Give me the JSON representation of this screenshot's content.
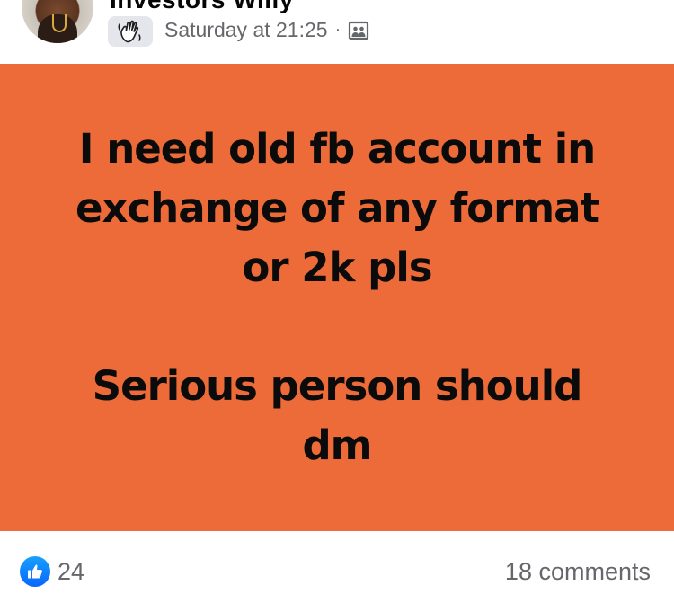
{
  "author": {
    "name": "Investors Willy"
  },
  "post_meta": {
    "timestamp": "Saturday at 21:25",
    "separator": "·",
    "audience_icon": "friends-audience-icon",
    "badge_icon": "wave-hand-icon"
  },
  "post": {
    "background_color": "#ec6b39",
    "text_color": "#0b0b0b",
    "lines": [
      "I need old fb account in",
      "exchange of any format",
      "or 2k pls",
      "Serious person should",
      "dm"
    ]
  },
  "reactions": {
    "icon": "like-icon",
    "count": "24",
    "color": "#0866ff"
  },
  "comments": {
    "label": "18 comments"
  }
}
